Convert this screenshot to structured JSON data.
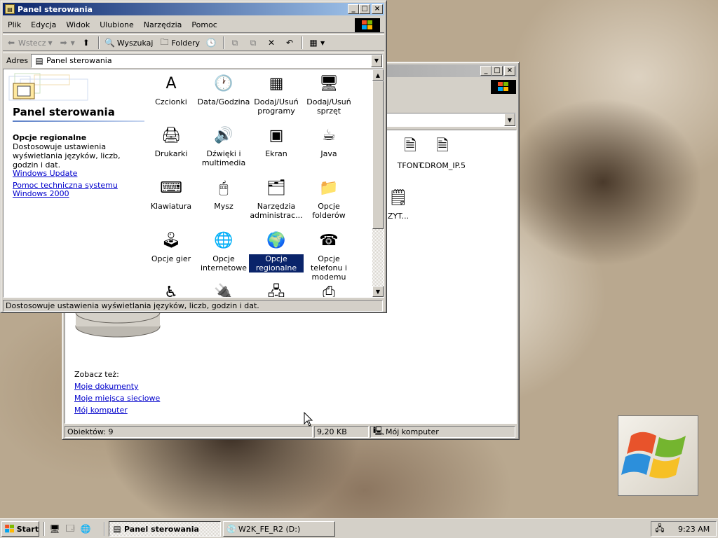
{
  "colors": {
    "title_active": "#0a246a",
    "selection": "#0a246a",
    "link": "#0000cc"
  },
  "back_window": {
    "statusbar": {
      "objects": "Obiektów: 9",
      "size": "9,20 KB",
      "location": "Mój komputer"
    },
    "files": [
      {
        "label": "TFONT"
      },
      {
        "label": "CDROM_IP.5"
      },
      {
        "label": "ZYT..."
      }
    ],
    "see_also_title": "Zobacz też:",
    "see_also_links": [
      "Moje dokumenty",
      "Moje miejsca sieciowe",
      "Mój komputer"
    ]
  },
  "front_window": {
    "title": "Panel sterowania",
    "menu": [
      "Plik",
      "Edycja",
      "Widok",
      "Ulubione",
      "Narzędzia",
      "Pomoc"
    ],
    "toolbar": {
      "back": "Wstecz",
      "search": "Wyszukaj",
      "folders": "Foldery"
    },
    "address_label": "Adres",
    "address_value": "Panel sterowania",
    "panel_heading": "Panel sterowania",
    "selected_item_title": "Opcje regionalne",
    "selected_item_desc": "Dostosowuje ustawienia wyświetlania języków, liczb, godzin i dat.",
    "links": [
      "Windows Update",
      "Pomoc techniczna systemu Windows 2000"
    ],
    "statusbar": "Dostosowuje ustawienia wyświetlania języków, liczb, godzin i dat.",
    "items": [
      {
        "label": "Czcionki",
        "icon": "fonts-folder-icon",
        "glyph": "A"
      },
      {
        "label": "Data/Godzina",
        "icon": "date-time-icon",
        "glyph": "🕐"
      },
      {
        "label": "Dodaj/Usuń programy",
        "icon": "add-remove-programs-icon",
        "glyph": "▦"
      },
      {
        "label": "Dodaj/Usuń sprzęt",
        "icon": "add-remove-hardware-icon",
        "glyph": "🖥"
      },
      {
        "label": "Drukarki",
        "icon": "printers-folder-icon",
        "glyph": "🖨"
      },
      {
        "label": "Dźwięki i multimedia",
        "icon": "speaker-icon",
        "glyph": "🔊"
      },
      {
        "label": "Ekran",
        "icon": "display-icon",
        "glyph": "▣"
      },
      {
        "label": "Java",
        "icon": "java-icon",
        "glyph": "☕"
      },
      {
        "label": "Klawiatura",
        "icon": "keyboard-icon",
        "glyph": "⌨"
      },
      {
        "label": "Mysz",
        "icon": "mouse-icon",
        "glyph": "🖱"
      },
      {
        "label": "Narzędzia administrac...",
        "icon": "admin-tools-icon",
        "glyph": "🗂"
      },
      {
        "label": "Opcje folderów",
        "icon": "folder-options-icon",
        "glyph": "📁"
      },
      {
        "label": "Opcje gier",
        "icon": "joystick-icon",
        "glyph": "🕹"
      },
      {
        "label": "Opcje internetowe",
        "icon": "internet-globe-icon",
        "glyph": "🌐"
      },
      {
        "label": "Opcje regionalne",
        "icon": "regional-globe-icon",
        "glyph": "🌍",
        "selected": true
      },
      {
        "label": "Opcje telefonu i modemu",
        "icon": "telephone-icon",
        "glyph": "☎"
      },
      {
        "label": "",
        "icon": "accessibility-icon",
        "glyph": "♿"
      },
      {
        "label": "",
        "icon": "power-options-icon",
        "glyph": "🔌"
      },
      {
        "label": "",
        "icon": "network-folder-icon",
        "glyph": "🖧"
      },
      {
        "label": "",
        "icon": "scanner-icon",
        "glyph": "⎙"
      }
    ]
  },
  "taskbar": {
    "start": "Start",
    "tasks": [
      "Panel sterowania",
      "W2K_FE_R2 (D:)"
    ],
    "clock": "9:23 AM"
  }
}
